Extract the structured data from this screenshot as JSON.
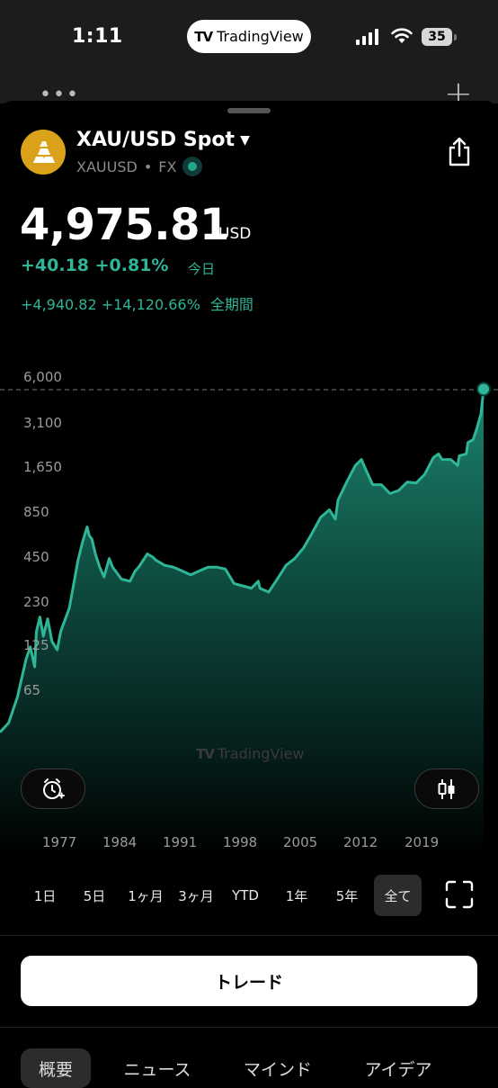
{
  "status_bar": {
    "time": "1:11",
    "app_pill": "TradingView",
    "battery": "35"
  },
  "symbol": {
    "title": "XAU/USD Spot",
    "ticker": "XAUUSD",
    "separator": "•",
    "market": "FX",
    "price": "4,975.81",
    "currency": "USD",
    "change_today": "+40.18 +0.81%",
    "change_today_label": "今日",
    "change_all": "+4,940.82 +14,120.66%",
    "change_all_label": "全期間"
  },
  "chart_data": {
    "type": "area",
    "scale": "log",
    "color": "#2fb597",
    "y_ticks": [
      "6,000",
      "3,100",
      "1,650",
      "850",
      "450",
      "230",
      "125",
      "65"
    ],
    "x_ticks": [
      "1977",
      "1984",
      "1991",
      "1998",
      "2005",
      "2012",
      "2019"
    ],
    "last_value": 4975.81,
    "x": [
      1970,
      1971,
      1972,
      1973,
      1973.5,
      1974,
      1974.2,
      1974.6,
      1975,
      1975.5,
      1976,
      1976.6,
      1977,
      1978,
      1979,
      1979.5,
      1980.05,
      1980.3,
      1980.6,
      1981,
      1981.5,
      1982,
      1982.6,
      1983,
      1984,
      1985,
      1985.6,
      1986,
      1987,
      1987.6,
      1988,
      1989,
      1990,
      1991,
      1992,
      1993,
      1994,
      1995,
      1996,
      1997,
      1998,
      1999,
      1999.8,
      2000,
      2001,
      2002,
      2003,
      2004,
      2005,
      2006,
      2007,
      2008,
      2008.7,
      2009,
      2010,
      2011,
      2011.7,
      2012,
      2013,
      2014,
      2015,
      2016,
      2017,
      2018,
      2019,
      2020,
      2020.6,
      2021,
      2022,
      2022.8,
      2023,
      2023.8,
      2024,
      2024.6,
      2025,
      2025.5,
      2025.8
    ],
    "y": [
      35,
      40,
      58,
      100,
      120,
      90,
      150,
      185,
      140,
      180,
      130,
      115,
      150,
      210,
      420,
      540,
      680,
      600,
      570,
      460,
      380,
      330,
      430,
      380,
      320,
      310,
      360,
      380,
      460,
      440,
      420,
      390,
      380,
      360,
      340,
      360,
      380,
      380,
      370,
      300,
      290,
      280,
      310,
      280,
      265,
      320,
      390,
      430,
      500,
      620,
      780,
      870,
      760,
      1000,
      1300,
      1650,
      1800,
      1650,
      1250,
      1250,
      1100,
      1150,
      1300,
      1280,
      1450,
      1850,
      1950,
      1800,
      1800,
      1650,
      1900,
      1950,
      2300,
      2400,
      2800,
      3500,
      4975.81
    ]
  },
  "watermark": "TradingView",
  "icons": {
    "alarm": "alarm-add-icon",
    "chart_style": "candlestick-icon",
    "share": "share-icon",
    "fullscreen": "fullscreen-icon"
  },
  "ranges": [
    "1日",
    "5日",
    "1ヶ月",
    "3ヶ月",
    "YTD",
    "1年",
    "5年",
    "全て"
  ],
  "selected_range": "全て",
  "trade_button": "トレード",
  "tabs": [
    "概要",
    "ニュース",
    "マインド",
    "アイデア"
  ],
  "selected_tab": "概要"
}
